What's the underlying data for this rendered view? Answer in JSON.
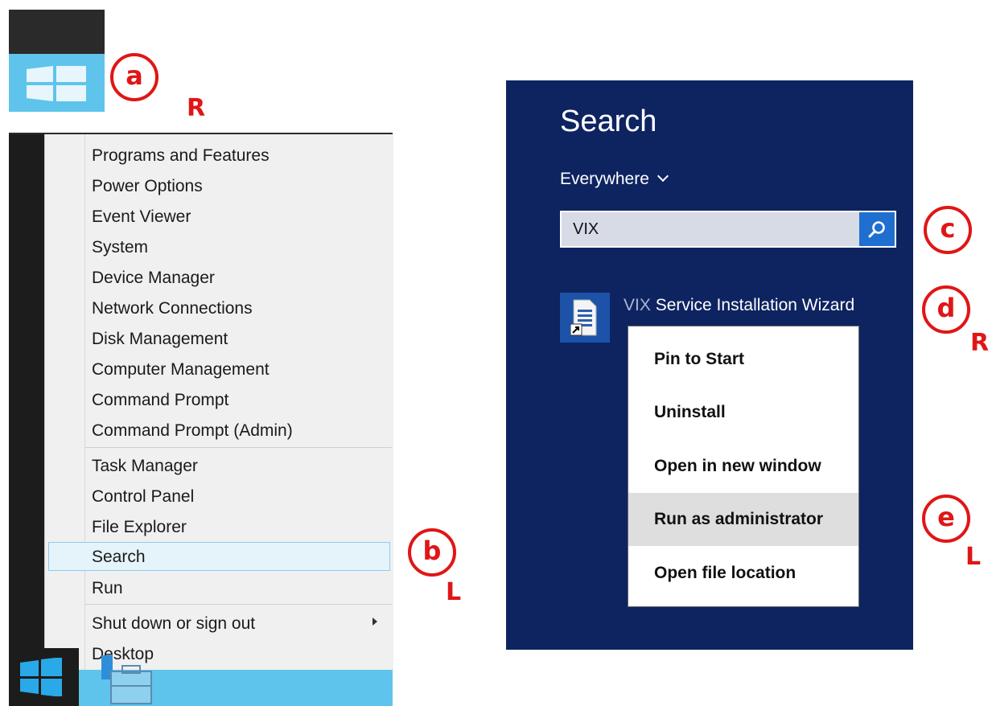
{
  "winx_menu": {
    "items": [
      {
        "label": "Programs and Features"
      },
      {
        "label": "Power Options"
      },
      {
        "label": "Event Viewer"
      },
      {
        "label": "System"
      },
      {
        "label": "Device Manager"
      },
      {
        "label": "Network Connections"
      },
      {
        "label": "Disk Management"
      },
      {
        "label": "Computer Management"
      },
      {
        "label": "Command Prompt"
      },
      {
        "label": "Command Prompt (Admin)"
      },
      {
        "label": "Task Manager"
      },
      {
        "label": "Control Panel"
      },
      {
        "label": "File Explorer"
      },
      {
        "label": "Search"
      },
      {
        "label": "Run"
      },
      {
        "label": "Shut down or sign out"
      },
      {
        "label": "Desktop"
      }
    ],
    "highlighted": "Search"
  },
  "search_charm": {
    "title": "Search",
    "scope": "Everywhere",
    "query": "VIX",
    "result": {
      "match": "VIX",
      "rest": " Service Installation Wizard"
    }
  },
  "context_menu": {
    "items": [
      {
        "label": "Pin to Start"
      },
      {
        "label": "Uninstall"
      },
      {
        "label": "Open in new window"
      },
      {
        "label": "Run as administrator"
      },
      {
        "label": "Open file location"
      }
    ],
    "active": "Run as administrator"
  },
  "annotations": [
    {
      "step": "a",
      "click": "R"
    },
    {
      "step": "b",
      "click": "L"
    },
    {
      "step": "c",
      "click": ""
    },
    {
      "step": "d",
      "click": "R"
    },
    {
      "step": "e",
      "click": "L"
    }
  ],
  "colors": {
    "charm_bg": "#0e2461",
    "accent_blue": "#1f6fd0",
    "start_tile": "#5ec4ec",
    "annotation_red": "#e01616",
    "menu_highlight": "#e5f3fb"
  },
  "icons": {
    "start_tile": "windows-logo-icon",
    "taskbar_start": "windows-logo-icon",
    "taskbar_app": "toolbox-icon",
    "search_button": "magnifier-icon",
    "result": "document-shortcut-icon"
  }
}
